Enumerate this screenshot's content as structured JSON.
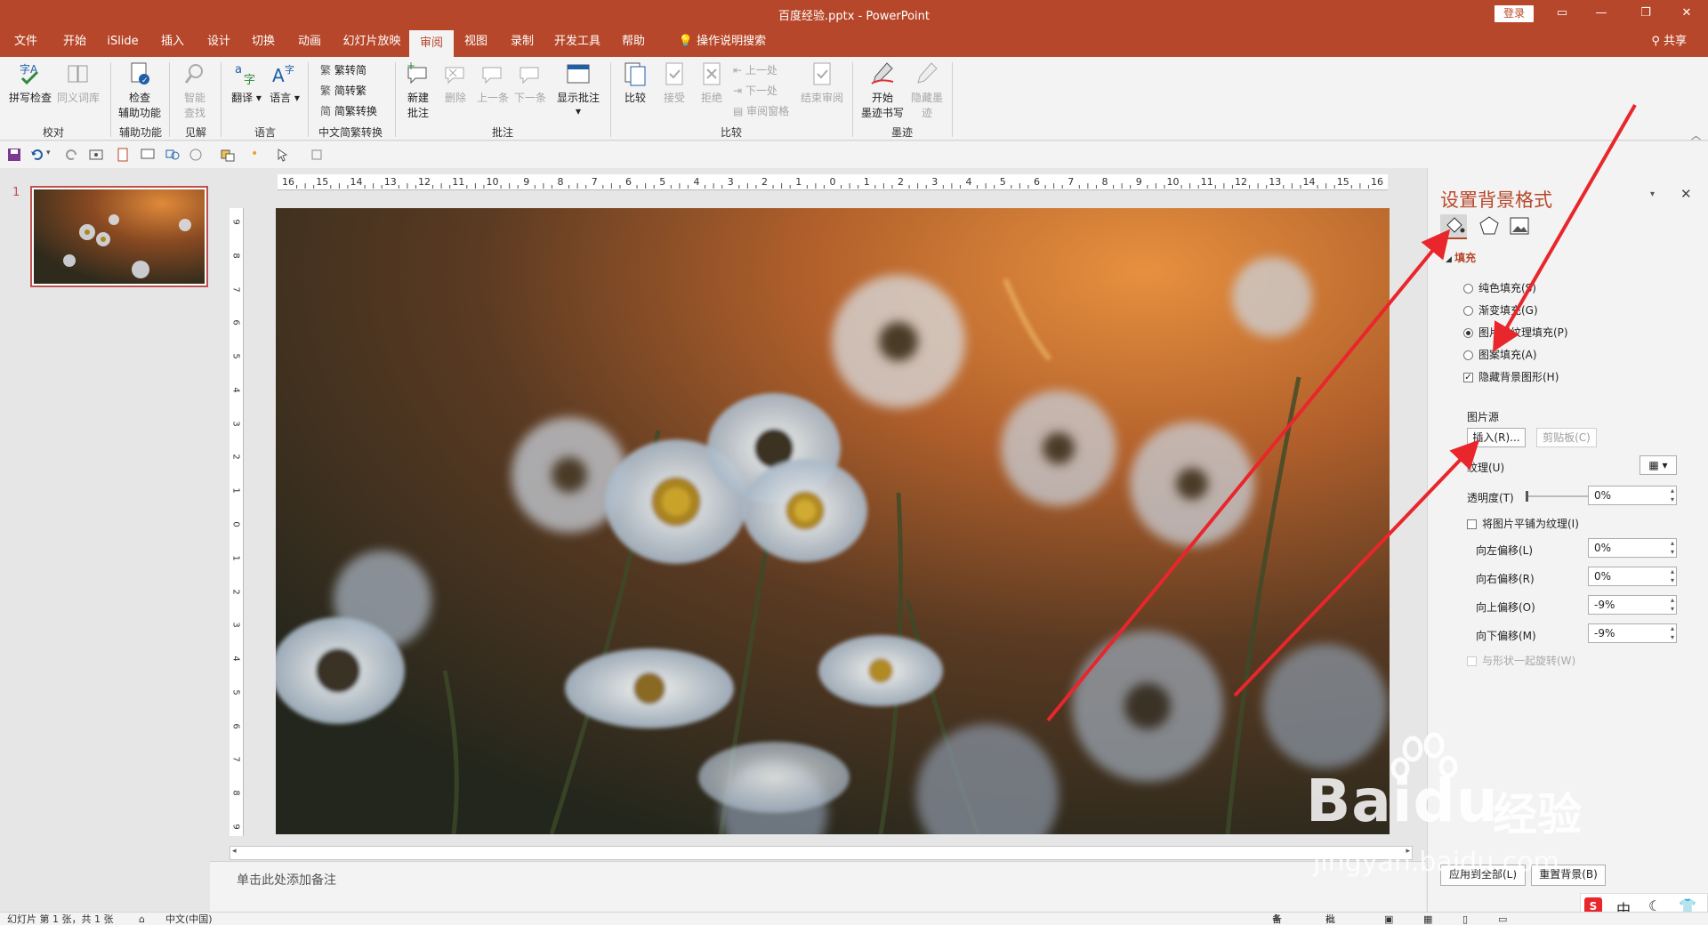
{
  "window": {
    "title": "百度经验.pptx  -  PowerPoint",
    "login": "登录",
    "share": "共享"
  },
  "menu": [
    "文件",
    "开始",
    "iSlide",
    "插入",
    "设计",
    "切换",
    "动画",
    "幻灯片放映",
    "审阅",
    "视图",
    "录制",
    "开发工具",
    "帮助",
    "操作说明搜索"
  ],
  "active_tab": "审阅",
  "ribbon": {
    "spell": "拼写检查",
    "thesaurus": "同义词库",
    "group_proof": "校对",
    "check_access_1": "检查",
    "check_access_2": "辅助功能",
    "group_access": "辅助功能",
    "smart_1": "智能",
    "smart_2": "查找",
    "group_insight": "见解",
    "translate": "翻译",
    "language": "语言",
    "group_lang": "语言",
    "t2s": "繁转简",
    "s2t": "简转繁",
    "convert": "简繁转换",
    "group_chinese": "中文简繁转换",
    "new_comment_1": "新建",
    "new_comment_2": "批注",
    "delete": "删除",
    "prev": "上一条",
    "next": "下一条",
    "show_comments": "显示批注",
    "group_comments": "批注",
    "compare": "比较",
    "accept": "接受",
    "reject": "拒绝",
    "prev_change": "上一处",
    "next_change": "下一处",
    "review_pane": "审阅窗格",
    "end_review": "结束审阅",
    "group_compare": "比较",
    "ink_start_1": "开始",
    "ink_start_2": "墨迹书写",
    "hide_ink_1": "隐藏墨",
    "hide_ink_2": "迹",
    "group_ink": "墨迹"
  },
  "ruler": {
    "h": [
      "16",
      "15",
      "14",
      "13",
      "12",
      "11",
      "10",
      "9",
      "8",
      "7",
      "6",
      "5",
      "4",
      "3",
      "2",
      "1",
      "0",
      "1",
      "2",
      "3",
      "4",
      "5",
      "6",
      "7",
      "8",
      "9",
      "10",
      "11",
      "12",
      "13",
      "14",
      "15",
      "16"
    ],
    "v": [
      "9",
      "8",
      "7",
      "6",
      "5",
      "4",
      "3",
      "2",
      "1",
      "0",
      "1",
      "2",
      "3",
      "4",
      "5",
      "6",
      "7",
      "8",
      "9"
    ]
  },
  "thumb": {
    "number": "1"
  },
  "notes": {
    "placeholder": "单击此处添加备注"
  },
  "pane": {
    "title": "设置背景格式",
    "section_fill": "填充",
    "solid": "纯色填充(S)",
    "gradient": "渐变填充(G)",
    "picture": "图片或纹理填充(P)",
    "pattern": "图案填充(A)",
    "hide_bg": "隐藏背景图形(H)",
    "picture_source": "图片源",
    "insert": "插入(R)...",
    "clipboard": "剪贴板(C)",
    "texture": "纹理(U)",
    "transparency": "透明度(T)",
    "transparency_val": "0%",
    "tile": "将图片平铺为纹理(I)",
    "offset_left": "向左偏移(L)",
    "offset_left_val": "0%",
    "offset_right": "向右偏移(R)",
    "offset_right_val": "0%",
    "offset_top": "向上偏移(O)",
    "offset_top_val": "-9%",
    "offset_bottom": "向下偏移(M)",
    "offset_bottom_val": "-9%",
    "rotate": "与形状一起旋转(W)",
    "apply_all": "应用到全部(L)",
    "reset": "重置背景(B)"
  },
  "status": {
    "slide": "幻灯片 第 1 张，共 1 张",
    "lang": "中文(中国)",
    "notes": "备注",
    "comments": "批注",
    "ime": "中"
  },
  "watermark": {
    "brand": "Baidu",
    "cn": "经验",
    "url": "jingyan.baidu.com"
  },
  "colors": {
    "accent": "#b7472a",
    "arrow": "#e8262b"
  }
}
